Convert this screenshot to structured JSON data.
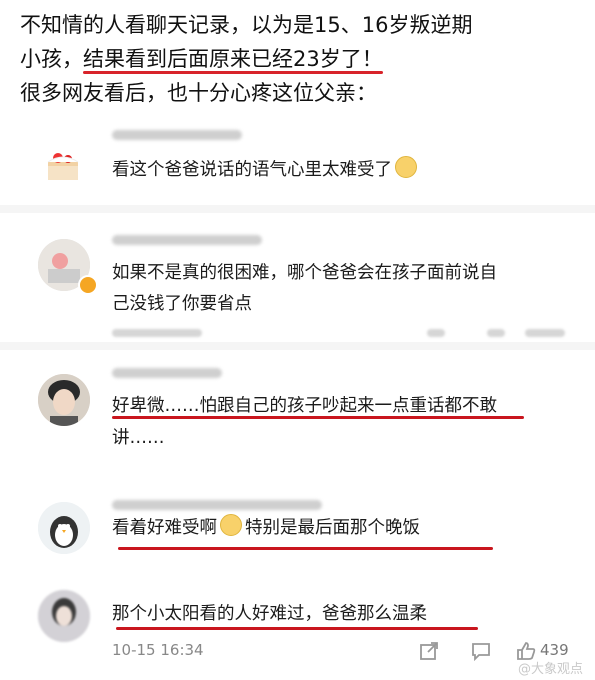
{
  "intro": {
    "line1": "不知情的人看聊天记录，以为是15、16岁叛逆期",
    "line2_a": "小孩，",
    "line2_b": "结果看到后面原来已经23岁了！",
    "line3": "很多网友看后，也十分心疼这位父亲："
  },
  "comments": [
    {
      "text1": "看这个爸爸说话的语气心里太难受了"
    },
    {
      "text1": "如果不是真的很困难，哪个爸爸会在孩子面前说自",
      "text2": "己没钱了你要省点"
    },
    {
      "text1": "好卑微……怕跟自己的孩子吵起来一点重话都不敢",
      "text2": "讲……"
    },
    {
      "text1": "看着好难受啊",
      "text1b": "特别是最后面那个晚饭"
    },
    {
      "text1": "那个小太阳看的人好难过，爸爸那么温柔"
    }
  ],
  "footer": {
    "time": "10-15 16:34",
    "like_count": "439",
    "watermark": "@大象观点"
  },
  "icons": [
    "cake-avatar-icon",
    "verified-badge-icon",
    "sad-emoji-icon",
    "crying-emoji-icon",
    "share-icon",
    "comment-icon",
    "like-icon"
  ],
  "colors": {
    "underline": "#c9161e",
    "verified": "#f5a623"
  }
}
